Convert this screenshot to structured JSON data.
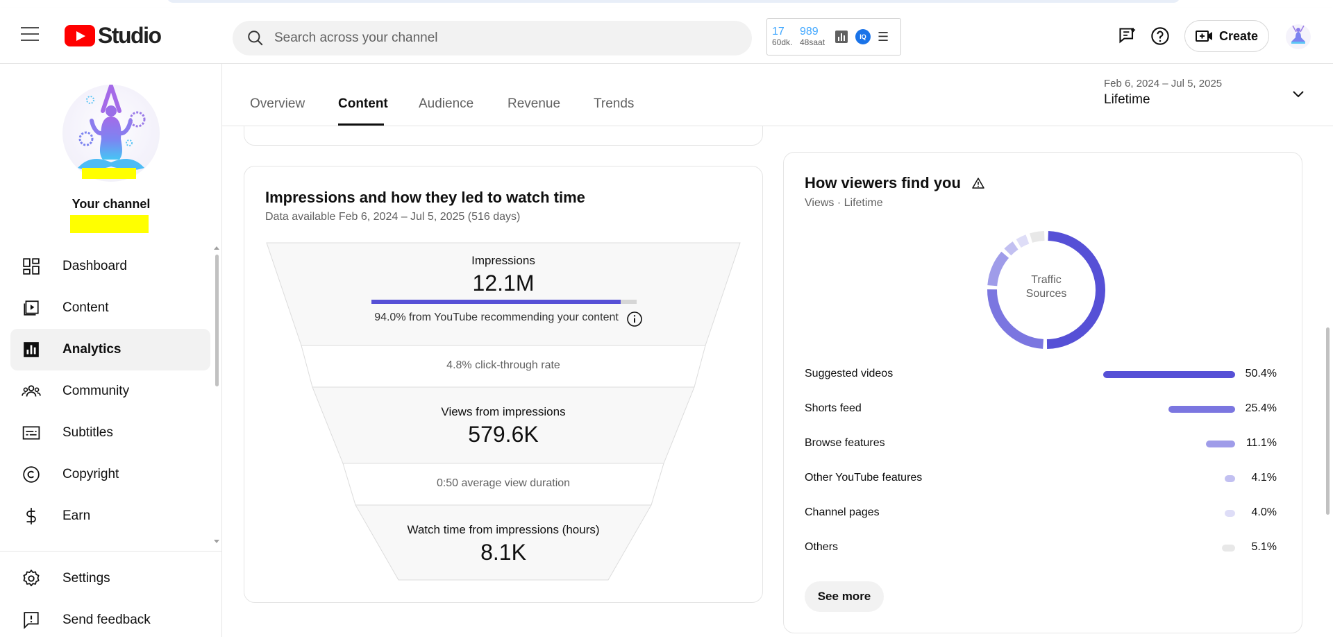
{
  "app": {
    "brand": "Studio"
  },
  "search": {
    "placeholder": "Search across your channel"
  },
  "stats_widget": {
    "left_value": "17",
    "left_label": "60dk.",
    "right_value": "989",
    "right_label": "48saat",
    "badge": "IQ"
  },
  "header": {
    "create_label": "Create"
  },
  "sidebar": {
    "channel_title": "Your channel",
    "items": [
      {
        "label": "Dashboard",
        "icon": "dashboard-icon"
      },
      {
        "label": "Content",
        "icon": "content-icon"
      },
      {
        "label": "Analytics",
        "icon": "analytics-icon",
        "active": true
      },
      {
        "label": "Community",
        "icon": "community-icon"
      },
      {
        "label": "Subtitles",
        "icon": "subtitles-icon"
      },
      {
        "label": "Copyright",
        "icon": "copyright-icon"
      },
      {
        "label": "Earn",
        "icon": "earn-icon"
      }
    ],
    "bottom_items": [
      {
        "label": "Settings",
        "icon": "gear-icon"
      },
      {
        "label": "Send feedback",
        "icon": "feedback-icon"
      }
    ]
  },
  "tabs": [
    {
      "label": "Overview"
    },
    {
      "label": "Content",
      "active": true
    },
    {
      "label": "Audience"
    },
    {
      "label": "Revenue"
    },
    {
      "label": "Trends"
    }
  ],
  "date_range": {
    "range": "Feb 6, 2024 – Jul 5, 2025",
    "label": "Lifetime"
  },
  "impressions_card": {
    "title": "Impressions and how they led to watch time",
    "subtitle": "Data available Feb 6, 2024 – Jul 5, 2025 (516 days)",
    "impressions_label": "Impressions",
    "impressions_value": "12.1M",
    "recommend_text": "94.0% from YouTube recommending your content",
    "recommend_fraction": 0.94,
    "ctr_text": "4.8% click-through rate",
    "views_label": "Views from impressions",
    "views_value": "579.6K",
    "avd_text": "0:50 average view duration",
    "watch_label": "Watch time from impressions (hours)",
    "watch_value": "8.1K"
  },
  "find_card": {
    "title": "How viewers find you",
    "subtitle": "Views · Lifetime",
    "donut_label_1": "Traffic",
    "donut_label_2": "Sources",
    "see_more": "See more"
  },
  "chart_data": {
    "type": "pie",
    "categories": [
      "Suggested videos",
      "Shorts feed",
      "Browse features",
      "Other YouTube features",
      "Channel pages",
      "Others"
    ],
    "values": [
      50.4,
      25.4,
      11.1,
      4.1,
      4.0,
      5.1
    ],
    "labels": [
      "50.4%",
      "25.4%",
      "11.1%",
      "4.1%",
      "4.0%",
      "5.1%"
    ],
    "colors": [
      "#5650d6",
      "#7b76e0",
      "#9f9ce9",
      "#c2c0f1",
      "#deddf7",
      "#e8e8e8"
    ]
  }
}
